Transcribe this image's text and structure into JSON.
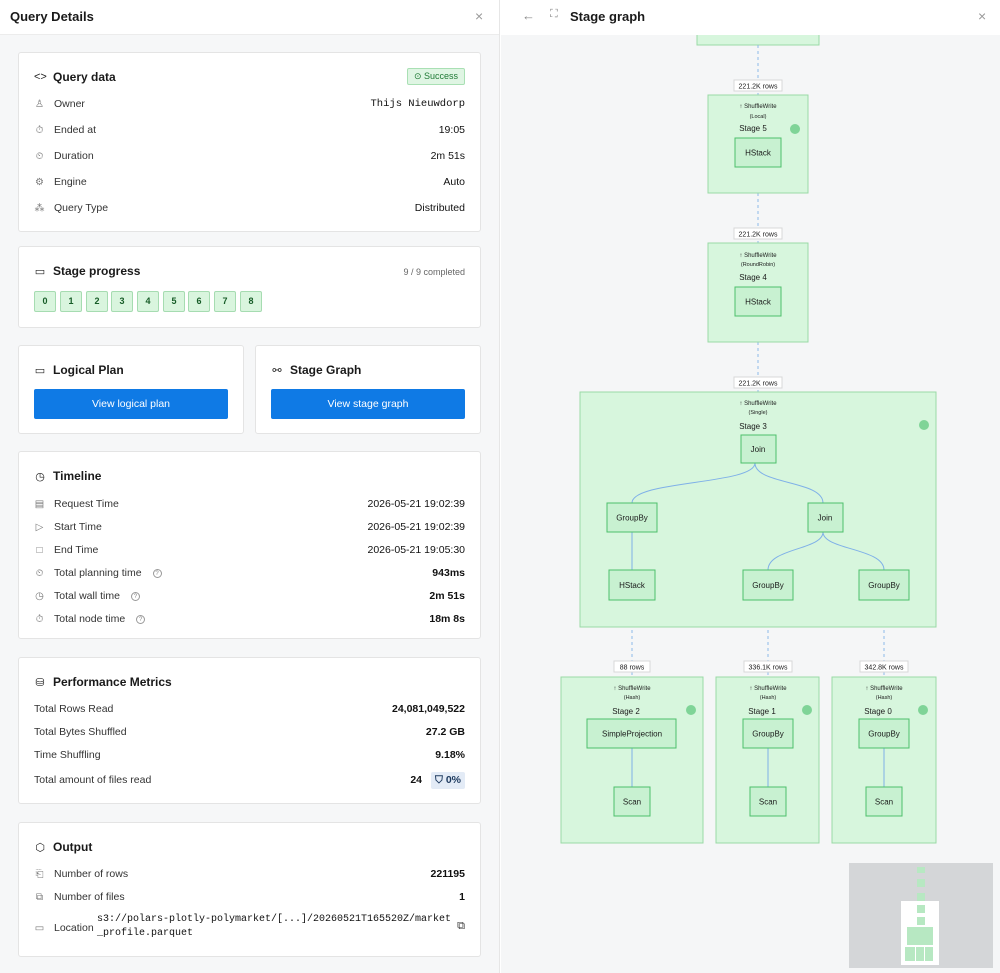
{
  "left": {
    "title": "Query Details",
    "close": "×",
    "query_data": {
      "title": "Query data",
      "status": "⊙ Success",
      "rows": [
        {
          "icon": "user-icon",
          "glyph": "♙",
          "label": "Owner",
          "value": "Thijs Nieuwdorp"
        },
        {
          "icon": "stopwatch-icon",
          "glyph": "⏱",
          "label": "Ended at",
          "value": "19:05"
        },
        {
          "icon": "timer-icon",
          "glyph": "⏲",
          "label": "Duration",
          "value": "2m 51s"
        },
        {
          "icon": "gear-icon",
          "glyph": "⚙",
          "label": "Engine",
          "value": "Auto"
        },
        {
          "icon": "network-icon",
          "glyph": "⁂",
          "label": "Query Type",
          "value": "Distributed"
        }
      ]
    },
    "stage_progress": {
      "title": "Stage progress",
      "summary": "9 / 9 completed",
      "stages": [
        "0",
        "1",
        "2",
        "3",
        "4",
        "5",
        "6",
        "7",
        "8"
      ]
    },
    "logical_plan": {
      "title": "Logical Plan",
      "button": "View logical plan"
    },
    "stage_graph_card": {
      "title": "Stage Graph",
      "button": "View stage graph"
    },
    "timeline": {
      "title": "Timeline",
      "rows": [
        {
          "icon": "calendar-icon",
          "glyph": "▤",
          "label": "Request Time",
          "value": "2026-05-21 19:02:39"
        },
        {
          "icon": "play-icon",
          "glyph": "▷",
          "label": "Start Time",
          "value": "2026-05-21 19:02:39"
        },
        {
          "icon": "stop-icon",
          "glyph": "□",
          "label": "End Time",
          "value": "2026-05-21 19:05:30"
        },
        {
          "icon": "timer-icon",
          "glyph": "⏲",
          "label": "Total planning time",
          "value": "943ms",
          "help": true
        },
        {
          "icon": "clock-icon",
          "glyph": "◷",
          "label": "Total wall time",
          "value": "2m 51s",
          "help": true
        },
        {
          "icon": "stopwatch-icon",
          "glyph": "⏱",
          "label": "Total node time",
          "value": "18m 8s",
          "help": true
        }
      ]
    },
    "performance": {
      "title": "Performance Metrics",
      "rows": [
        {
          "label": "Total Rows Read",
          "value": "24,081,049,522"
        },
        {
          "label": "Total Bytes Shuffled",
          "value": "27.2 GB"
        },
        {
          "label": "Time Shuffling",
          "value": "9.18%"
        }
      ],
      "files_label": "Total amount of files read",
      "files_value": "24",
      "files_filter": "⛉ 0%"
    },
    "output": {
      "title": "Output",
      "rows": [
        {
          "icon": "rows-icon",
          "glyph": "⎗",
          "label": "Number of rows",
          "value": "221195"
        },
        {
          "icon": "files-icon",
          "glyph": "⧉",
          "label": "Number of files",
          "value": "1"
        }
      ],
      "location_label": "Location",
      "location_value": "s3://polars-plotly-polymarket/[...]/20260521T165520Z/market_profile.parquet"
    }
  },
  "right": {
    "title": "Stage graph",
    "back": "←",
    "expand": "⛶",
    "close": "×",
    "row_labels": [
      "221.2K rows",
      "221.2K rows",
      "221.2K rows",
      "88 rows",
      "336.1K rows",
      "342.8K rows"
    ],
    "stages": [
      {
        "name": "Stage 5",
        "write": "↑ ShuffleWrite",
        "mode": "(Local)"
      },
      {
        "name": "Stage 4",
        "write": "↑ ShuffleWrite",
        "mode": "(RoundRobin)"
      },
      {
        "name": "Stage 3",
        "write": "↑ ShuffleWrite",
        "mode": "(Single)"
      },
      {
        "name": "Stage 2",
        "write": "↑ ShuffleWrite",
        "mode": "(Hash)"
      },
      {
        "name": "Stage 1",
        "write": "↑ ShuffleWrite",
        "mode": "(Hash)"
      },
      {
        "name": "Stage 0",
        "write": "↑ ShuffleWrite",
        "mode": "(Hash)"
      }
    ],
    "nodes": {
      "s5": "HStack",
      "s4": "HStack",
      "s3_join": "Join",
      "s3_groupby_left": "GroupBy",
      "s3_join_right": "Join",
      "s3_hstack": "HStack",
      "s3_groupby_mid": "GroupBy",
      "s3_groupby_right": "GroupBy",
      "s2_proj": "SimpleProjection",
      "s2_scan": "Scan",
      "s1_groupby": "GroupBy",
      "s1_scan": "Scan",
      "s0_groupby": "GroupBy",
      "s0_scan": "Scan"
    }
  },
  "colors": {
    "accent": "#0f7ae5",
    "success": "#1f7a35",
    "stage_fill": "#d7f6dd",
    "node_border": "#4dc06b"
  }
}
